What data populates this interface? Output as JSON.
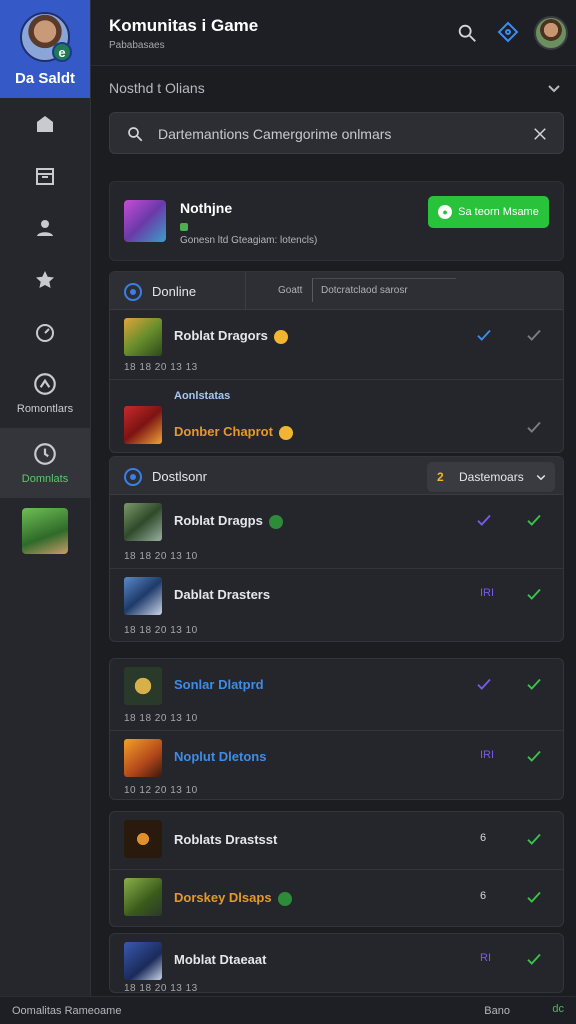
{
  "sidebar": {
    "profile_name": "Da Saldt",
    "profile_badge": "e",
    "nav_block_1": "Romontlars",
    "nav_block_2": "Domnlats"
  },
  "header": {
    "title": "Komunitas i Game",
    "subtitle": "Pababasaes"
  },
  "section": {
    "label": "Nosthd t Olians"
  },
  "search": {
    "text": "Dartemantions Camergorime onlmars"
  },
  "feature": {
    "name": "Nothjne",
    "desc": "Gonesn ltd Gteagiam: lotencls)",
    "button": "Sa teorn Msame"
  },
  "panel1": {
    "filter": "Donline",
    "filter_tag": "Goatt",
    "filter_box": "Dotcratclaod sarosr",
    "rows": [
      {
        "title": "Roblat Dragors",
        "time": "18 18 20 13 13",
        "mid": "",
        "title_color": ""
      },
      {
        "title": "Aonlstatas",
        "sub": "Donber Chaprot",
        "time": "",
        "mid": "",
        "title_color": "orange"
      }
    ]
  },
  "panel2": {
    "filter": "Dostlsonr",
    "dropdown": "Dastemoars",
    "dropdown_num": "2",
    "rows": [
      {
        "title": "Roblat Dragps",
        "time": "18 18 20 13 10",
        "mid": ""
      },
      {
        "title": "Dablat Drasters",
        "time": "18 18 20 13 10",
        "mid": "IRI"
      }
    ]
  },
  "panel3": {
    "rows": [
      {
        "title": "Sonlar Dlatprd",
        "time": "18 18 20 13 10",
        "mid": ""
      },
      {
        "title": "Noplut Dletons",
        "time": "10 12 20 13 10",
        "mid": "IRI"
      }
    ]
  },
  "panel4": {
    "rows": [
      {
        "title": "Roblats Drastsst",
        "time": "",
        "mid": "6"
      },
      {
        "title": "Dorskey Dlsaps",
        "time": "",
        "mid": "6"
      }
    ]
  },
  "panel5": {
    "rows": [
      {
        "title": "Moblat Dtaeaat",
        "time": "18 18 20 13 13",
        "mid": "RI"
      }
    ]
  },
  "footer": {
    "left": "Oomalitas Rameoame",
    "right": "Bano",
    "check": "dc"
  }
}
